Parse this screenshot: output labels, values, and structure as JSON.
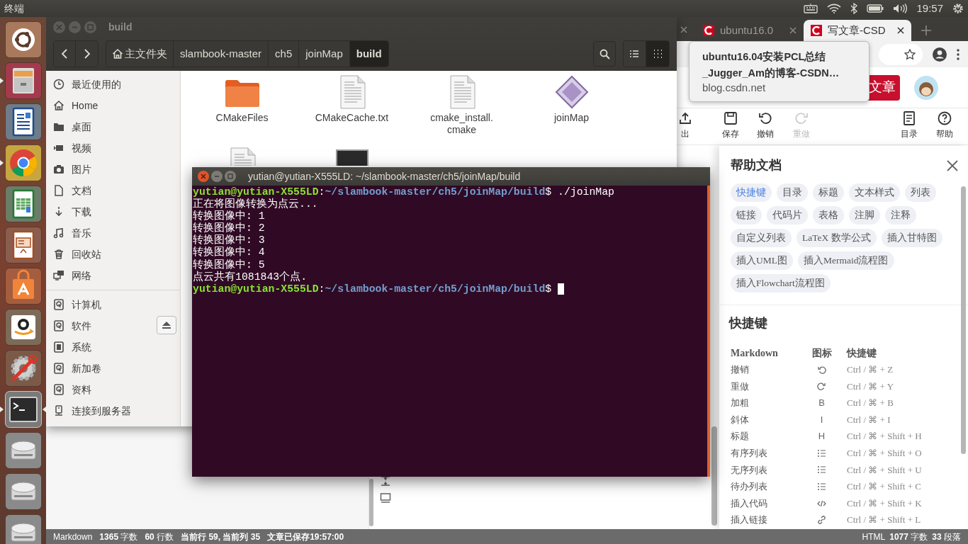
{
  "top_panel": {
    "app_title": "终端",
    "clock": "19:57"
  },
  "launcher": [
    {
      "kind": "dash",
      "running": false,
      "focused": false
    },
    {
      "kind": "files",
      "running": true,
      "focused": false
    },
    {
      "kind": "writer",
      "running": false,
      "focused": false
    },
    {
      "kind": "browser",
      "running": true,
      "focused": false
    },
    {
      "kind": "calc",
      "running": false,
      "focused": false
    },
    {
      "kind": "impress",
      "running": false,
      "focused": false
    },
    {
      "kind": "software",
      "running": false,
      "focused": false
    },
    {
      "kind": "amazon",
      "running": false,
      "focused": false
    },
    {
      "kind": "settings",
      "running": false,
      "focused": false
    },
    {
      "kind": "terminal",
      "running": true,
      "focused": true
    },
    {
      "kind": "drive",
      "running": false,
      "focused": false
    },
    {
      "kind": "drive",
      "running": false,
      "focused": false
    },
    {
      "kind": "drive",
      "running": false,
      "focused": false
    }
  ],
  "browser": {
    "tabs": [
      {
        "title": "ubuntu16.0",
        "selected": false
      },
      {
        "title": "写文章-CSD",
        "selected": true
      }
    ],
    "tooltip": {
      "lines": [
        "ubuntu16.04安装PCL总结",
        "_Jugger_Am的博客-CSDN…"
      ],
      "url": "blog.csdn.net"
    },
    "publish_button": "文章",
    "toolbar": [
      {
        "kind": "export",
        "label": "出",
        "disabled": false
      },
      {
        "kind": "save",
        "label": "保存",
        "disabled": false
      },
      {
        "kind": "undo",
        "label": "撤销",
        "disabled": false
      },
      {
        "kind": "redo",
        "label": "重做",
        "disabled": true
      },
      {
        "kind": "toc",
        "label": "目录",
        "disabled": false
      },
      {
        "kind": "help",
        "label": "帮助",
        "disabled": false
      }
    ],
    "help_panel": {
      "title": "帮助文档",
      "chips": [
        {
          "label": "快捷键",
          "selected": true
        },
        {
          "label": "目录",
          "selected": false
        },
        {
          "label": "标题",
          "selected": false
        },
        {
          "label": "文本样式",
          "selected": false
        },
        {
          "label": "列表",
          "selected": false
        },
        {
          "label": "链接",
          "selected": false
        },
        {
          "label": "代码片",
          "selected": false
        },
        {
          "label": "表格",
          "selected": false
        },
        {
          "label": "注脚",
          "selected": false
        },
        {
          "label": "注释",
          "selected": false
        },
        {
          "label": "自定义列表",
          "selected": false
        },
        {
          "label": "LaTeX 数学公式",
          "selected": false
        },
        {
          "label": "插入甘特图",
          "selected": false
        },
        {
          "label": "插入UML图",
          "selected": false
        },
        {
          "label": "插入Mermaid流程图",
          "selected": false
        },
        {
          "label": "插入Flowchart流程图",
          "selected": false
        }
      ],
      "section_title": "快捷键",
      "columns": [
        "Markdown",
        "图标",
        "快捷键"
      ],
      "rows": [
        {
          "name": "撤销",
          "icon": {
            "kind": "undo"
          },
          "shortcut": "Ctrl / ⌘ + Z"
        },
        {
          "name": "重做",
          "icon": {
            "kind": "redo"
          },
          "shortcut": "Ctrl / ⌘ + Y"
        },
        {
          "name": "加粗",
          "icon": {
            "kind": "glyph",
            "glyph": "B"
          },
          "shortcut": "Ctrl / ⌘ + B"
        },
        {
          "name": "斜体",
          "icon": {
            "kind": "glyph",
            "glyph": "I"
          },
          "shortcut": "Ctrl / ⌘ + I"
        },
        {
          "name": "标题",
          "icon": {
            "kind": "glyph",
            "glyph": "H"
          },
          "shortcut": "Ctrl / ⌘ + Shift + H"
        },
        {
          "name": "有序列表",
          "icon": {
            "kind": "list"
          },
          "shortcut": "Ctrl / ⌘ + Shift + O"
        },
        {
          "name": "无序列表",
          "icon": {
            "kind": "list"
          },
          "shortcut": "Ctrl / ⌘ + Shift + U"
        },
        {
          "name": "待办列表",
          "icon": {
            "kind": "list"
          },
          "shortcut": "Ctrl / ⌘ + Shift + C"
        },
        {
          "name": "插入代码",
          "icon": {
            "kind": "code"
          },
          "shortcut": "Ctrl / ⌘ + Shift + K"
        },
        {
          "name": "插入链接",
          "icon": {
            "kind": "link"
          },
          "shortcut": "Ctrl / ⌘ + Shift + L"
        }
      ]
    },
    "status_bar": {
      "left": [
        {
          "text": "Markdown",
          "bold": false
        },
        {
          "text": "**1365** 字数",
          "bold": false
        },
        {
          "text": "**60** 行数",
          "bold": false
        },
        {
          "text": "当前行 59, 当前列 35",
          "bold": true
        },
        {
          "text": "文章已保存19:57:00",
          "bold": true
        }
      ],
      "right": [
        {
          "text": "HTML",
          "bold": false
        },
        {
          "text": "**1077** 字数",
          "bold": false
        },
        {
          "text": "**33** 段落",
          "bold": false
        }
      ]
    }
  },
  "file_manager": {
    "title": "build",
    "view_buttons": [
      {
        "kind": "list",
        "selected": false
      },
      {
        "kind": "grid",
        "selected": true
      }
    ],
    "breadcrumbs": [
      {
        "label": "主文件夹",
        "home": true,
        "selected": false
      },
      {
        "label": "slambook-master",
        "home": false,
        "selected": false
      },
      {
        "label": "ch5",
        "home": false,
        "selected": false
      },
      {
        "label": "joinMap",
        "home": false,
        "selected": false
      },
      {
        "label": "build",
        "home": false,
        "selected": true
      }
    ],
    "sidebar": [
      [
        {
          "kind": "recent",
          "label": "最近使用的"
        },
        {
          "kind": "home",
          "label": "Home"
        },
        {
          "kind": "folder",
          "label": "桌面"
        },
        {
          "kind": "video",
          "label": "视频"
        },
        {
          "kind": "camera",
          "label": "图片"
        },
        {
          "kind": "document",
          "label": "文档"
        },
        {
          "kind": "download",
          "label": "下载"
        },
        {
          "kind": "music",
          "label": "音乐"
        },
        {
          "kind": "trash",
          "label": "回收站"
        },
        {
          "kind": "network",
          "label": "网络"
        }
      ],
      [
        {
          "kind": "drive",
          "label": "计算机",
          "ejectable": false
        },
        {
          "kind": "drive",
          "label": "软件",
          "ejectable": true
        },
        {
          "kind": "chip",
          "label": "系统",
          "ejectable": false
        },
        {
          "kind": "drive",
          "label": "新加卷",
          "ejectable": false
        },
        {
          "kind": "drive",
          "label": "资料",
          "ejectable": false
        },
        {
          "kind": "server",
          "label": "连接到服务器",
          "ejectable": false
        }
      ]
    ],
    "files": [
      {
        "kind": "folder",
        "name": "CMakeFiles"
      },
      {
        "kind": "text",
        "name": "CMakeCache.txt"
      },
      {
        "kind": "text",
        "name": "cmake_install.cmake"
      },
      {
        "kind": "executable",
        "name": "joinMap"
      },
      {
        "kind": "text"
      },
      {
        "kind": "binary"
      }
    ]
  },
  "terminal": {
    "title": "yutian@yutian-X555LD: ~/slambook-master/ch5/joinMap/build",
    "lines": [
      {
        "kind": "prompt",
        "user": "yutian@yutian-X555LD",
        "sep": ":",
        "path": "~/slambook-master/ch5/joinMap/build",
        "symbol": "$",
        "command": "./joinMap",
        "cursor": false
      },
      {
        "kind": "output",
        "text": "正在将图像转换为点云..."
      },
      {
        "kind": "output",
        "text": "转换图像中: 1"
      },
      {
        "kind": "output",
        "text": "转换图像中: 2"
      },
      {
        "kind": "output",
        "text": "转换图像中: 3"
      },
      {
        "kind": "output",
        "text": "转换图像中: 4"
      },
      {
        "kind": "output",
        "text": "转换图像中: 5"
      },
      {
        "kind": "output",
        "text": "点云共有1081843个点."
      },
      {
        "kind": "prompt",
        "user": "yutian@yutian-X555LD",
        "sep": ":",
        "path": "~/slambook-master/ch5/joinMap/build",
        "symbol": "$",
        "cursor": true
      }
    ]
  }
}
